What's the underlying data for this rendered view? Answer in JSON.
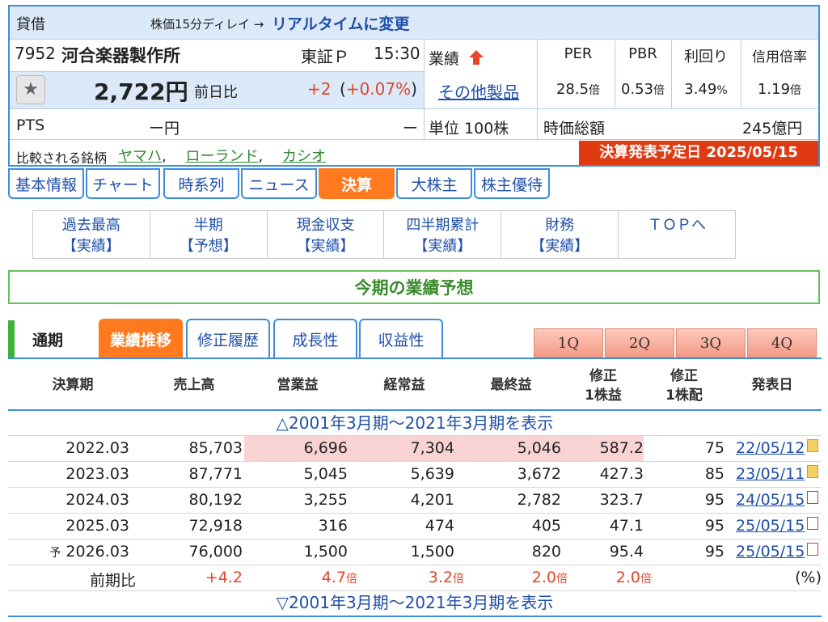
{
  "header": {
    "type_label": "貸借",
    "delay_note": "株価15分ディレイ →",
    "realtime_link": "リアルタイムに変更",
    "code": "7952",
    "name": "河合楽器製作所",
    "market": "東証Ｐ",
    "time": "15:30",
    "price": "2,722円",
    "change_label": "前日比",
    "change": "+2",
    "change_pct": "(+0.07%)",
    "pts_label": "PTS",
    "pts_price": "ー円",
    "pts_change": "ー",
    "compare_label": "比較される銘柄",
    "compare_items": [
      "ヤマハ",
      "ローランド",
      "カシオ"
    ],
    "gyoseki_label": "業績",
    "industry_link": "その他製品",
    "unit": "単位 100株",
    "metrics": [
      {
        "label": "PER",
        "value": "28.5",
        "unit": "倍"
      },
      {
        "label": "PBR",
        "value": "0.53",
        "unit": "倍"
      },
      {
        "label": "利回り",
        "value": "3.49",
        "unit": "%"
      },
      {
        "label": "信用倍率",
        "value": "1.19",
        "unit": "倍"
      }
    ],
    "market_cap_label": "時価総額",
    "market_cap_value": "245億円",
    "announce_banner": "決算発表予定日 2025/05/15"
  },
  "tabs": [
    "基本情報",
    "チャート",
    "時系列",
    "ニュース",
    "決算",
    "大株主",
    "株主優待"
  ],
  "active_tab": 4,
  "submenu": [
    {
      "top": "過去最高",
      "bottom": "【実績】"
    },
    {
      "top": "半期",
      "bottom": "【予想】"
    },
    {
      "top": "現金収支",
      "bottom": "【実績】"
    },
    {
      "top": "四半期累計",
      "bottom": "【実績】"
    },
    {
      "top": "財務",
      "bottom": "【実績】"
    },
    {
      "top": "ＴＯＰへ",
      "bottom": ""
    }
  ],
  "section_title": "今期の業績予想",
  "period_label": "通期",
  "lower_tabs": [
    "業績推移",
    "修正履歴",
    "成長性",
    "収益性"
  ],
  "quarter_buttons": [
    "1Q",
    "2Q",
    "3Q",
    "4Q"
  ],
  "columns": [
    "決算期",
    "売上高",
    "営業益",
    "経常益",
    "最終益",
    "修正\n1株益",
    "修正\n1株配",
    "発表日"
  ],
  "expand_top": "△2001年3月期～2021年3月期を表示",
  "expand_bottom": "▽2001年3月期～2021年3月期を表示",
  "rows": [
    {
      "prefix": "",
      "period": "2022.03",
      "sales": "85,703",
      "op": "6,696",
      "ord": "7,304",
      "net": "5,046",
      "eps": "587.2",
      "dps": "75",
      "date": "22/05/12"
    },
    {
      "prefix": "",
      "period": "2023.03",
      "sales": "87,771",
      "op": "5,045",
      "ord": "5,639",
      "net": "3,672",
      "eps": "427.3",
      "dps": "85",
      "date": "23/05/11"
    },
    {
      "prefix": "",
      "period": "2024.03",
      "sales": "80,192",
      "op": "3,255",
      "ord": "4,201",
      "net": "2,782",
      "eps": "323.7",
      "dps": "95",
      "date": "24/05/15"
    },
    {
      "prefix": "",
      "period": "2025.03",
      "sales": "72,918",
      "op": "316",
      "ord": "474",
      "net": "405",
      "eps": "47.1",
      "dps": "95",
      "date": "25/05/15"
    },
    {
      "prefix": "予",
      "period": "2026.03",
      "sales": "76,000",
      "op": "1,500",
      "ord": "1,500",
      "net": "820",
      "eps": "95.4",
      "dps": "95",
      "date": "25/05/15"
    }
  ],
  "yoy": {
    "label": "前期比",
    "sales": "+4.2",
    "op": "4.7",
    "ord": "3.2",
    "net": "2.0",
    "eps": "2.0",
    "unit_times": "倍",
    "pct": "(%)"
  },
  "colors": {
    "accent": "#3d8ee0",
    "active": "#ff7a1f",
    "green": "#3a8a2b",
    "highlight": "#f9d3d3",
    "banner": "#e03a12"
  }
}
